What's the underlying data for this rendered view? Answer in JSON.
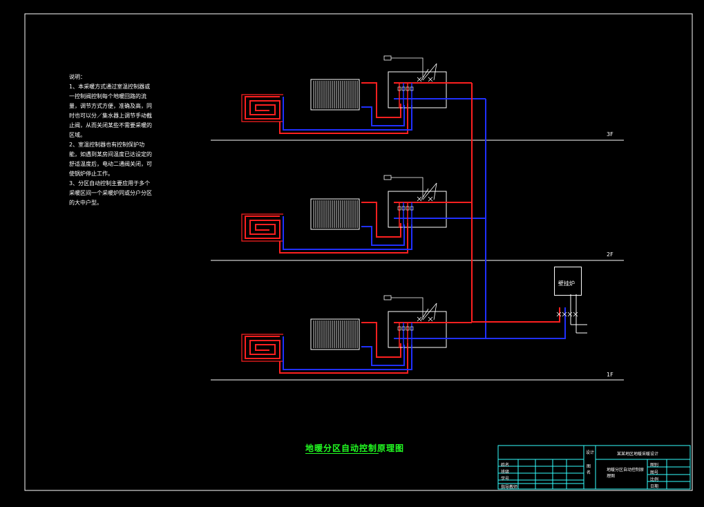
{
  "notes": {
    "heading": "说明：",
    "items": [
      "1、本采暖方式通过室温控制器或一控制阀控制每个地暖回路的流量，调节方式方便，准确及高，同时也可以分／集水器上调节手动截止阀，从而关闭某些不需要采暖的区域。",
      "2、室温控制器也有控制保护功能，如遇到某房间温度已达设定的舒适温度后，电动二通阀关闭，可使锅炉停止工作。",
      "3、分区自动控制主要应用于多个采暖区间一个采暖炉同或分户分区的大中户型。"
    ]
  },
  "floors": [
    {
      "label": "3F"
    },
    {
      "label": "2F"
    },
    {
      "label": "1F"
    }
  ],
  "boiler_label": "壁挂炉",
  "title": "地暖分区自动控制原理图",
  "title_block": {
    "project": "某某地区地暖采暖设计",
    "drawing_name_label": "图名",
    "drawing_name": "地暖分区自动控制原理图",
    "left_rows": [
      "姓名",
      "班级",
      "学号",
      "指导教师"
    ],
    "right_rows": [
      "图别",
      "图号",
      "比例",
      "日期"
    ],
    "col_label": "设计"
  },
  "colors": {
    "supply": "#ff2020",
    "return": "#2030ff",
    "frame": "#ffffff",
    "title": "#22ff22",
    "title_block": "#33ffff"
  }
}
